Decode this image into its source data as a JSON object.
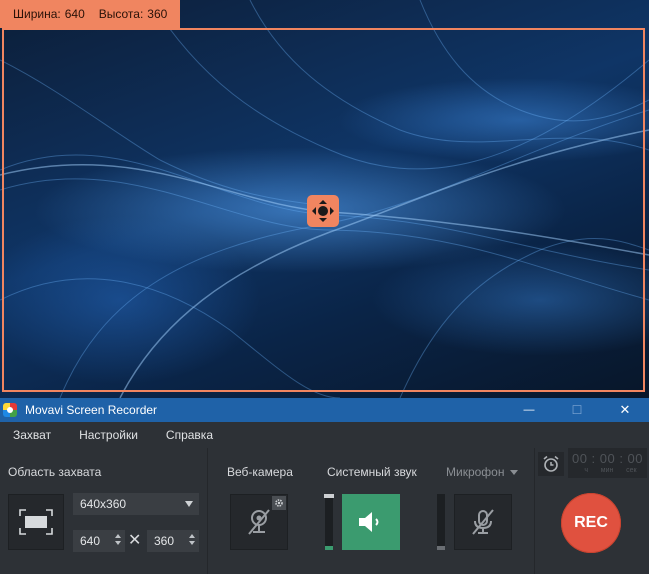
{
  "capture": {
    "width_label": "Ширина:",
    "width_value": "640",
    "height_label": "Высота:",
    "height_value": "360"
  },
  "window": {
    "title": "Movavi Screen Recorder",
    "minimize_symbol": "—",
    "maximize_symbol": "☐",
    "close_symbol": "✕"
  },
  "menu": [
    {
      "label": "Захват"
    },
    {
      "label": "Настройки"
    },
    {
      "label": "Справка"
    }
  ],
  "area": {
    "title": "Область захвата",
    "preset": "640x360",
    "width": "640",
    "height": "360",
    "times_symbol": "✕"
  },
  "media": {
    "webcam_label": "Веб-камера",
    "system_sound_label": "Системный звук",
    "microphone_label": "Микрофон",
    "system_sound_level": 0.07,
    "microphone_level": 0.07
  },
  "rec": {
    "timer": "00 : 00 : 00",
    "units": [
      "ч",
      "мин",
      "сек"
    ],
    "button_label": "REC"
  },
  "colors": {
    "accent": "#f08560",
    "titlebar": "#1f62a8",
    "active_green": "#3b9b6f",
    "rec_red": "#e0513f"
  }
}
